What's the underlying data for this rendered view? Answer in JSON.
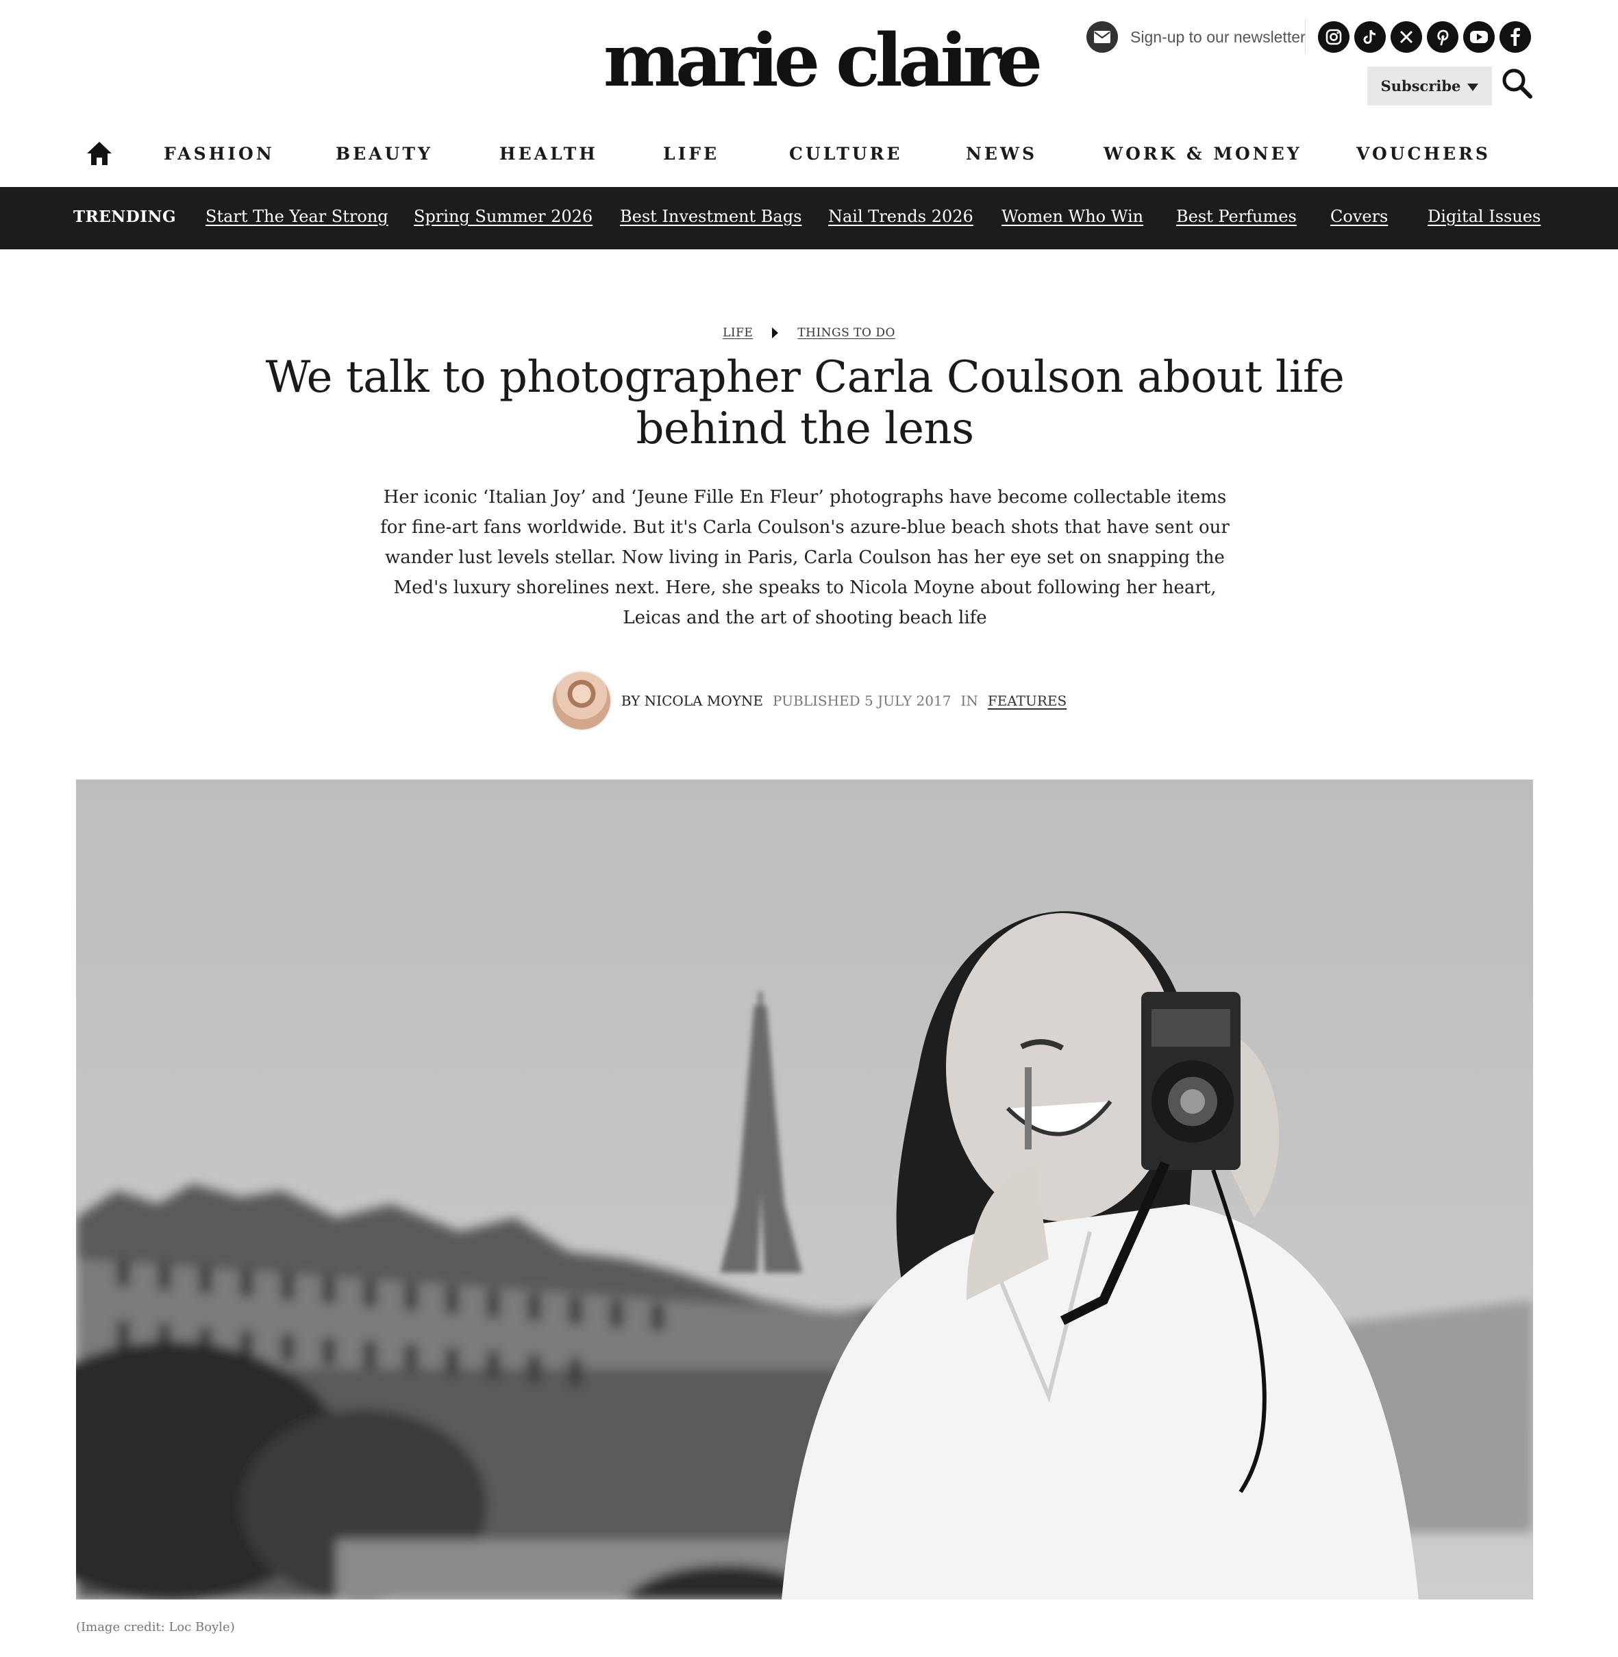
{
  "brand": {
    "logo_text": "marie claire"
  },
  "header": {
    "newsletter_label": "Sign-up to our newsletter",
    "subscribe_label": "Subscribe",
    "social": [
      {
        "name": "instagram-icon",
        "glyph": "◎"
      },
      {
        "name": "tiktok-icon",
        "glyph": "♪"
      },
      {
        "name": "x-icon",
        "glyph": "X"
      },
      {
        "name": "pinterest-icon",
        "glyph": "P"
      },
      {
        "name": "youtube-icon",
        "glyph": "▶"
      },
      {
        "name": "facebook-icon",
        "glyph": "f"
      }
    ]
  },
  "nav": {
    "items": [
      "FASHION",
      "BEAUTY",
      "HEALTH",
      "LIFE",
      "CULTURE",
      "NEWS",
      "WORK & MONEY",
      "VOUCHERS"
    ]
  },
  "trending": {
    "label": "TRENDING",
    "links": [
      "Start The Year Strong",
      "Spring Summer 2026",
      "Best Investment Bags",
      "Nail Trends 2026",
      "Women Who Win",
      "Best Perfumes",
      "Covers",
      "Digital Issues"
    ]
  },
  "article": {
    "breadcrumb": [
      "LIFE",
      "THINGS TO DO"
    ],
    "headline": "We talk to photographer Carla Coulson about life behind the lens",
    "standfirst": "Her iconic ‘Italian Joy’ and ‘Jeune Fille En Fleur’ photographs have become collectable items for fine-art fans worldwide. But it's Carla Coulson's azure-blue beach shots that have sent our wander lust levels stellar. Now living in Paris, Carla Coulson has her eye set on snapping the Med's luxury shorelines next. Here, she speaks to Nicola Moyne about following her heart, Leicas and the art of shooting beach life",
    "byline": {
      "by": "BY NICOLA MOYNE",
      "published": "PUBLISHED 5 JULY 2017",
      "in": "IN",
      "category": "FEATURES"
    },
    "image_caption": "(Image credit: Loc Boyle)"
  },
  "colors": {
    "trending_bar": "#1c1c1c",
    "subscribe_bg": "#e8e8e8",
    "text": "#1a1a1a"
  }
}
